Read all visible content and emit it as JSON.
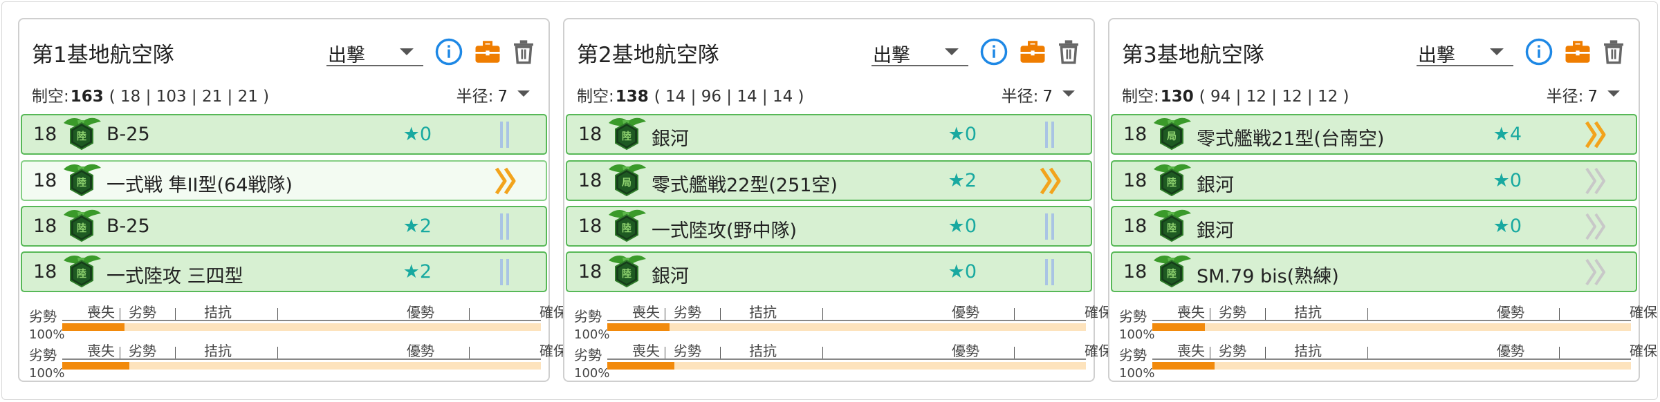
{
  "colors": {
    "slot_bg": "#d7f0d2",
    "slot_border": "#57b857",
    "star": "#18a9a0",
    "info": "#1e88e5",
    "toolbox": "#ef7d00",
    "gauge_fill": "#f28a0c",
    "gauge_track": "#fde3bd",
    "prof_max": "#f2a31c",
    "prof_bars": "#a9c4e4",
    "prof_zero": "#c8c8c8"
  },
  "cards": [
    {
      "title": "第1基地航空隊",
      "mode": "出撃",
      "stats": {
        "label": "制空:",
        "value": "163",
        "detail": "( 18 | 103 | 21 | 21 )"
      },
      "radius": {
        "label": "半径:",
        "value": "7"
      },
      "slots": [
        {
          "count": "18",
          "badge": "陸",
          "name": "B-25",
          "star": "★0",
          "proficiency": "bars"
        },
        {
          "count": "18",
          "badge": "陸",
          "name": "一式戦 隼II型(64戦隊)",
          "star": "",
          "proficiency": "max"
        },
        {
          "count": "18",
          "badge": "陸",
          "name": "B-25",
          "star": "★2",
          "proficiency": "bars"
        },
        {
          "count": "18",
          "badge": "陸",
          "name": "一式陸攻 三四型",
          "star": "★2",
          "proficiency": "bars"
        }
      ],
      "gauges": [
        {
          "labels": [
            "劣勢",
            "喪失",
            "劣勢",
            "拮抗",
            "優勢",
            "確保"
          ],
          "percent": "100%",
          "fill": 0.13
        },
        {
          "labels": [
            "劣勢",
            "喪失",
            "劣勢",
            "拮抗",
            "優勢",
            "確保"
          ],
          "percent": "100%",
          "fill": 0.14
        }
      ]
    },
    {
      "title": "第2基地航空隊",
      "mode": "出撃",
      "stats": {
        "label": "制空:",
        "value": "138",
        "detail": "( 14 | 96 | 14 | 14 )"
      },
      "radius": {
        "label": "半径:",
        "value": "7"
      },
      "slots": [
        {
          "count": "18",
          "badge": "陸",
          "name": "銀河",
          "star": "★0",
          "proficiency": "bars"
        },
        {
          "count": "18",
          "badge": "局",
          "name": "零式艦戦22型(251空)",
          "star": "★2",
          "proficiency": "max"
        },
        {
          "count": "18",
          "badge": "陸",
          "name": "一式陸攻(野中隊)",
          "star": "★0",
          "proficiency": "bars"
        },
        {
          "count": "18",
          "badge": "陸",
          "name": "銀河",
          "star": "★0",
          "proficiency": "bars"
        }
      ],
      "gauges": [
        {
          "labels": [
            "劣勢",
            "喪失",
            "劣勢",
            "拮抗",
            "優勢",
            "確保"
          ],
          "percent": "100%",
          "fill": 0.13
        },
        {
          "labels": [
            "劣勢",
            "喪失",
            "劣勢",
            "拮抗",
            "優勢",
            "確保"
          ],
          "percent": "100%",
          "fill": 0.14
        }
      ]
    },
    {
      "title": "第3基地航空隊",
      "mode": "出撃",
      "stats": {
        "label": "制空:",
        "value": "130",
        "detail": "( 94 | 12 | 12 | 12 )"
      },
      "radius": {
        "label": "半径:",
        "value": "7"
      },
      "slots": [
        {
          "count": "18",
          "badge": "局",
          "name": "零式艦戦21型(台南空)",
          "star": "★4",
          "proficiency": "max"
        },
        {
          "count": "18",
          "badge": "陸",
          "name": "銀河",
          "star": "★0",
          "proficiency": "zero"
        },
        {
          "count": "18",
          "badge": "陸",
          "name": "銀河",
          "star": "★0",
          "proficiency": "zero"
        },
        {
          "count": "18",
          "badge": "陸",
          "name": "SM.79 bis(熟練)",
          "star": "",
          "proficiency": "zero"
        }
      ],
      "gauges": [
        {
          "labels": [
            "劣勢",
            "喪失",
            "劣勢",
            "拮抗",
            "優勢",
            "確保"
          ],
          "percent": "100%",
          "fill": 0.11
        },
        {
          "labels": [
            "劣勢",
            "喪失",
            "劣勢",
            "拮抗",
            "優勢",
            "確保"
          ],
          "percent": "100%",
          "fill": 0.13
        }
      ]
    }
  ]
}
